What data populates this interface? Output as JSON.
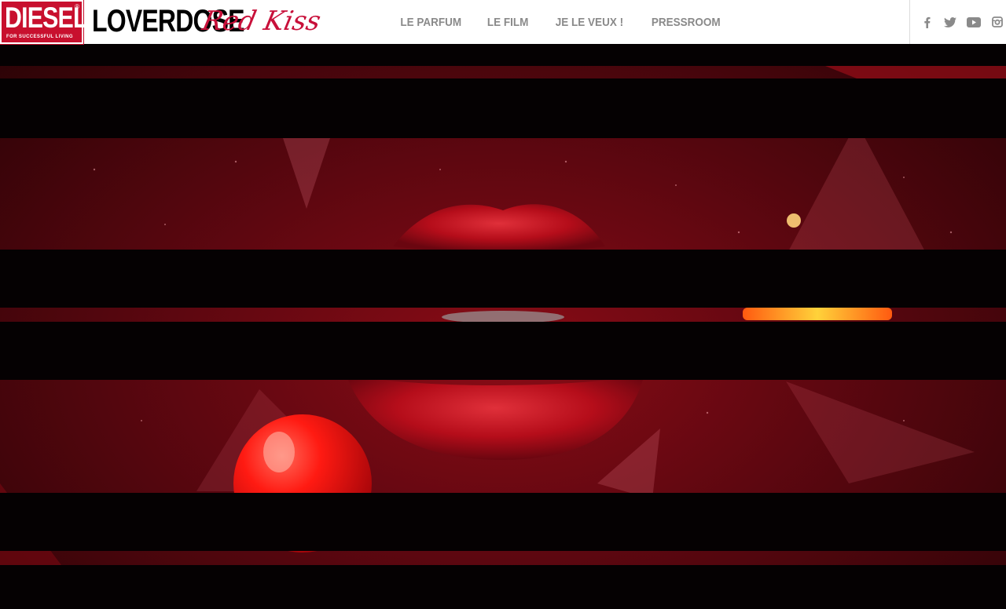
{
  "brand": {
    "name": "DIESEL",
    "registered": "®",
    "tagline": "FOR SUCCESSFUL LIVING"
  },
  "product": {
    "name": "LOVERDOSE",
    "subline": "Red Kiss"
  },
  "nav": {
    "items": [
      {
        "label": "LE PARFUM"
      },
      {
        "label": "LE FILM"
      },
      {
        "label": "JE LE VEUX !"
      },
      {
        "label": "PRESSROOM"
      }
    ]
  },
  "social": {
    "icons": [
      "facebook-icon",
      "twitter-icon",
      "youtube-icon",
      "instagram-icon"
    ]
  },
  "colors": {
    "brand_red": "#c8102e",
    "script_red": "#c8103a",
    "nav_gray": "#8a8a8a",
    "lip_red": "#c4101c"
  }
}
